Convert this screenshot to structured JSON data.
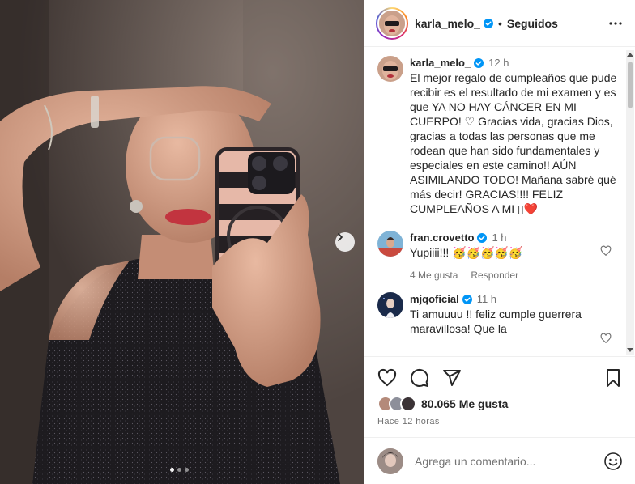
{
  "post": {
    "author": "karla_melo_",
    "follow_status": "Seguidos",
    "caption_time": "12 h",
    "caption": "El mejor regalo de cumpleaños que pude recibir es el resultado de mi examen y es que YA NO HAY CÁNCER EN MI CUERPO! ♡ Gracias vida, gracias Dios, gracias a todas las personas que me rodean que han sido fundamentales y especiales en este camino!! AÚN ASIMILANDO TODO! Mañana sabré qué más decir! GRACIAS!!!! FELIZ CUMPLEAÑOS A MI ▯❤️"
  },
  "comments": [
    {
      "user": "fran.crovetto",
      "time": "1 h",
      "text": "Yupiiii!!! 🥳🥳🥳🥳🥳",
      "likes": "4 Me gusta",
      "reply": "Responder"
    },
    {
      "user": "mjqoficial",
      "time": "11 h",
      "text": "Ti amuuuu !! feliz cumple guerrera maravillosa! Que la"
    }
  ],
  "stats": {
    "likes": "80.065 Me gusta",
    "posted": "Hace 12 horas"
  },
  "composer": {
    "placeholder": "Agrega un comentario..."
  },
  "carousel": {
    "slides": 3,
    "active": 0
  },
  "colors": {
    "verified": "#0095f6",
    "like_red": "#ed4956",
    "text": "#262626",
    "muted": "#737373"
  },
  "icons": {
    "verified": "verified-badge-icon",
    "more": "more-options-icon",
    "like": "heart-icon",
    "comment": "comment-icon",
    "share": "share-icon",
    "save": "bookmark-icon",
    "emoji": "emoji-icon",
    "next": "chevron-right-icon"
  }
}
